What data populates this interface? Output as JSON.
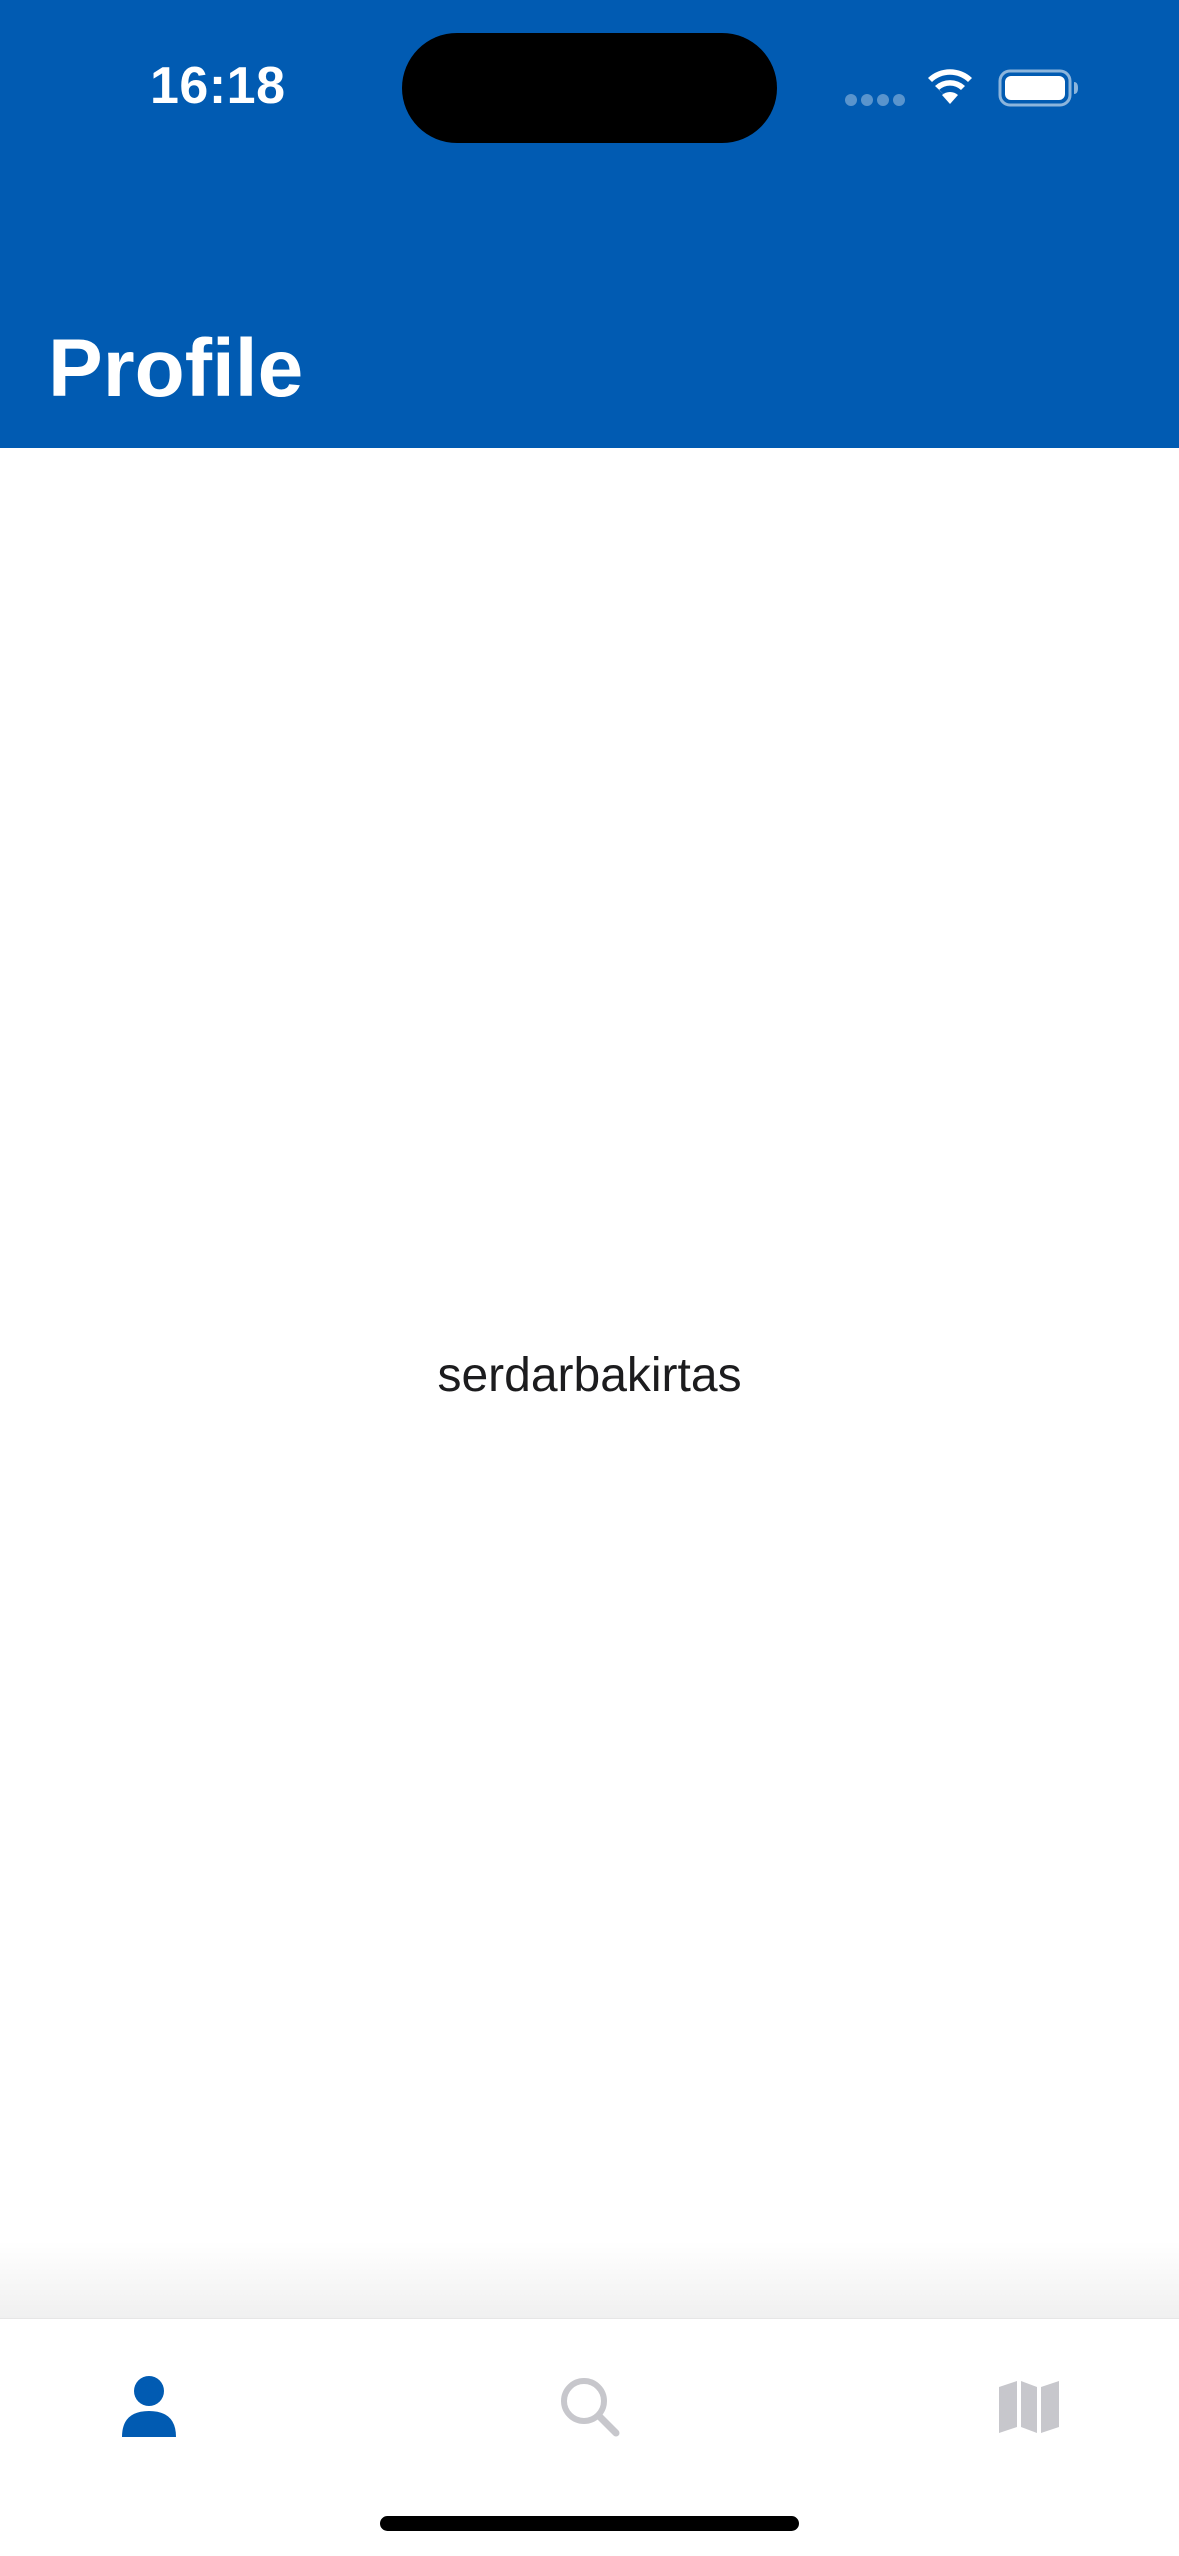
{
  "status_bar": {
    "time": "16:18",
    "icons": [
      "signal-dots-icon",
      "wifi-icon",
      "battery-icon"
    ]
  },
  "header": {
    "title": "Profile",
    "background_color": "#015BB2"
  },
  "profile": {
    "username": "serdarbakirtas"
  },
  "tab_bar": {
    "tabs": [
      {
        "icon": "person-icon",
        "selected": true,
        "color": "#015BB2"
      },
      {
        "icon": "search-icon",
        "selected": false,
        "color": "#C7C7CC"
      },
      {
        "icon": "map-icon",
        "selected": false,
        "color": "#C7C7CC"
      }
    ]
  }
}
